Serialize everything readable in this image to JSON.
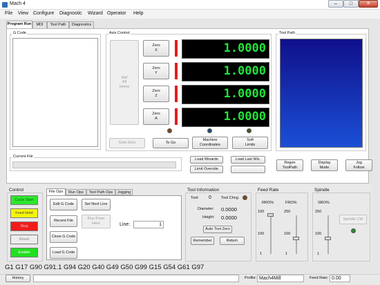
{
  "window": {
    "title": "Mach 4",
    "min": "–",
    "max": "□",
    "close": "✕"
  },
  "menu": [
    "File",
    "View",
    "Configure",
    "Diagnostic",
    "Wizard",
    "Operator",
    "Help"
  ],
  "tabs": [
    "Program Run",
    "MDI",
    "Tool Path",
    "Diagnostics"
  ],
  "gcode": {
    "label": "G Code"
  },
  "axis": {
    "label": "Axis Control",
    "ref_all_home": "Ref\nAll\nHome",
    "rows": [
      {
        "zero": "Zero\nX",
        "value": "1.0000"
      },
      {
        "zero": "Zero\nY",
        "value": "1.0000"
      },
      {
        "zero": "Zero\nZ",
        "value": "1.0000"
      },
      {
        "zero": "Zero\nA",
        "value": "1.0000"
      }
    ],
    "goto_zero": "Goto Zero",
    "to_go": "To Go",
    "machine_coords": "Machine\nCoordinates",
    "soft_limits": "Soft\nLimits",
    "led_colors": [
      "#7a4a1a",
      "#1f4a7a",
      "#3c5a22"
    ]
  },
  "toolpath": {
    "label": "Tool Path",
    "bg_top": "#10108a",
    "bg_bottom": "#1a4fd6"
  },
  "current_file": {
    "label": "Current File"
  },
  "wizards": {
    "load_wizards": "Load Wizards",
    "load_last_wiz": "Load Last Wiz.",
    "limit_override": "Limit Override"
  },
  "view_buttons": {
    "regen": "Regen\nToolPath",
    "display_mode": "Display\nMode",
    "jog_follow": "Jog\nFollow"
  },
  "control": {
    "label": "Control",
    "cycle_start": "Cycle Start",
    "feed_hold": "Feed Hold",
    "stop": "Stop",
    "reset": "Reset",
    "enable": "Enable"
  },
  "subtabs": [
    "File Ops",
    "Run Ops",
    "Tool Path Ops",
    "Jogging"
  ],
  "fileops": {
    "edit_gcode": "Edit G Code",
    "set_next_line": "Set Next Line",
    "recent_file": "Recent File",
    "run_from_here": "Run From\nHere",
    "close_gcode": "Close G Code",
    "load_gcode": "Load G Code",
    "line_label": "Line:",
    "line_value": "1"
  },
  "toolinfo": {
    "label": "Tool Information",
    "tool_label": "Tool:",
    "tool_value": "0",
    "tool_chng": "Tool Chng.",
    "diameter_label": "Diameter:",
    "diameter_value": "0.0000",
    "height_label": "Height:",
    "height_value": "0.0000",
    "auto_tool_zero": "Auto Tool Zero",
    "remember": "Remember",
    "return": "Return"
  },
  "feedrate": {
    "label": "Feed Rate",
    "rro": "RRO%",
    "fro": "FRO%",
    "rro_top": "100",
    "fro_top": "250",
    "rro_mid": "100",
    "fro_mid": "100",
    "rro_bottom": "1",
    "fro_bottom": "1",
    "rro_value": 100,
    "fro_value": 100
  },
  "spindle": {
    "label": "Spindle",
    "sro": "SRO%",
    "sro_top": "250",
    "sro_mid": "100",
    "sro_bottom": "1",
    "sro_value": 100,
    "spindle_cw": "Spindle CW"
  },
  "gcode_line": "G1 G17 G90 G91.1 G94 G20 G40 G49 G50 G99 G15 G54 G61 G97",
  "status": {
    "history": "History",
    "profile_label": "Profile:",
    "profile_value": "Mach4Mill",
    "feed_rate_label": "Feed Rate:",
    "feed_rate_value": "0.00"
  }
}
